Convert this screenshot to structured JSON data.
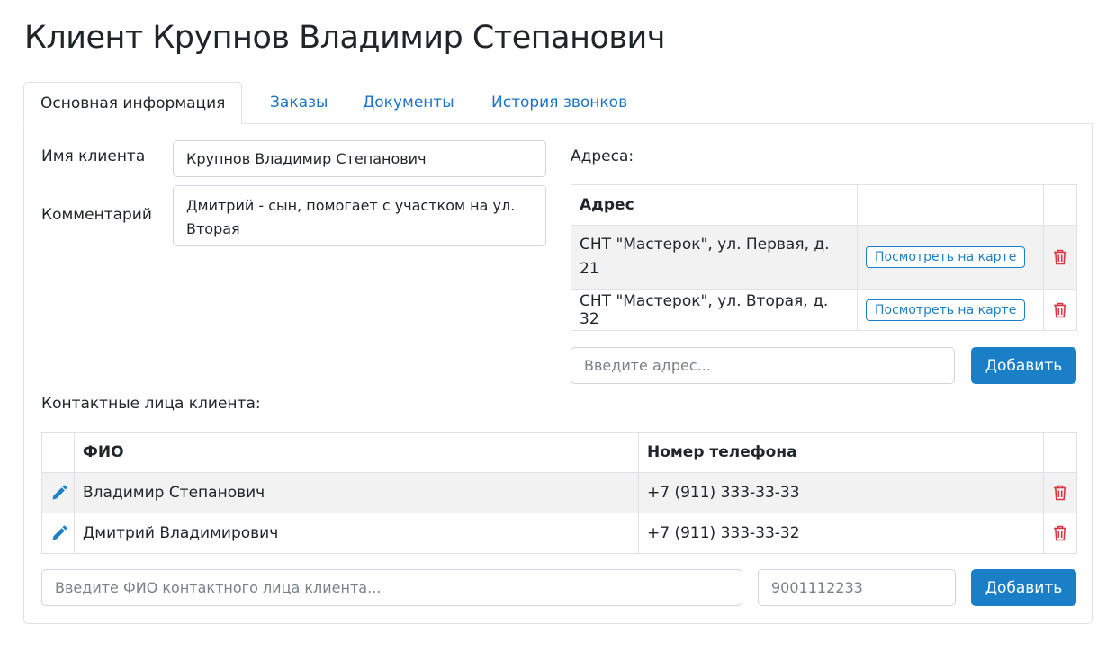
{
  "page": {
    "title": "Клиент Крупнов Владимир Степанович"
  },
  "tabs": [
    {
      "label": "Основная информация",
      "active": true
    },
    {
      "label": "Заказы",
      "active": false
    },
    {
      "label": "Документы",
      "active": false
    },
    {
      "label": "История звонков",
      "active": false
    }
  ],
  "client": {
    "name_label": "Имя клиента",
    "name_value": "Крупнов Владимир Степанович",
    "comment_label": "Комментарий",
    "comment_value": "Дмитрий - сын, помогает с участком на ул. Вторая"
  },
  "addresses": {
    "heading": "Адреса:",
    "column_header": "Адрес",
    "rows": [
      {
        "address": "СНТ \"Мастерок\", ул. Первая, д. 21",
        "map_label": "Посмотреть на карте"
      },
      {
        "address": "СНТ \"Мастерок\", ул. Вторая, д. 32",
        "map_label": "Посмотреть на карте"
      }
    ],
    "input_placeholder": "Введите адрес...",
    "add_label": "Добавить"
  },
  "contacts": {
    "heading": "Контактные лица клиента:",
    "columns": {
      "name": "ФИО",
      "phone": "Номер телефона"
    },
    "rows": [
      {
        "name": "Владимир Степанович",
        "phone": "+7 (911) 333-33-33"
      },
      {
        "name": "Дмитрий Владимирович",
        "phone": "+7 (911) 333-33-32"
      }
    ],
    "name_placeholder": "Введите ФИО контактного лица клиента...",
    "phone_placeholder": "9001112233",
    "add_label": "Добавить"
  },
  "colors": {
    "accent": "#1a7fc7",
    "link": "#1a73c8",
    "danger": "#dc3545",
    "stripe": "#f2f2f2",
    "border": "#dee2e6"
  },
  "icons": {
    "edit": "pencil-icon",
    "delete": "trash-icon"
  }
}
